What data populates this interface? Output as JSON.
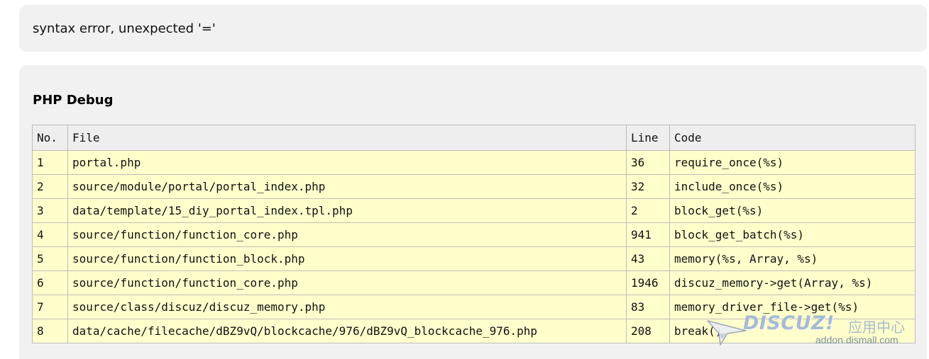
{
  "error": {
    "message": "syntax error, unexpected '='"
  },
  "debug": {
    "title": "PHP Debug",
    "columns": {
      "no": "No.",
      "file": "File",
      "line": "Line",
      "code": "Code"
    },
    "rows": [
      {
        "no": "1",
        "file": "portal.php",
        "line": "36",
        "code": "require_once(%s)"
      },
      {
        "no": "2",
        "file": "source/module/portal/portal_index.php",
        "line": "32",
        "code": "include_once(%s)"
      },
      {
        "no": "3",
        "file": "data/template/15_diy_portal_index.tpl.php",
        "line": "2",
        "code": "block_get(%s)"
      },
      {
        "no": "4",
        "file": "source/function/function_core.php",
        "line": "941",
        "code": "block_get_batch(%s)"
      },
      {
        "no": "5",
        "file": "source/function/function_block.php",
        "line": "43",
        "code": "memory(%s, Array, %s)"
      },
      {
        "no": "6",
        "file": "source/function/function_core.php",
        "line": "1946",
        "code": "discuz_memory->get(Array, %s)"
      },
      {
        "no": "7",
        "file": "source/class/discuz/discuz_memory.php",
        "line": "83",
        "code": "memory_driver_file->get(%s)"
      },
      {
        "no": "8",
        "file": "data/cache/filecache/dBZ9vQ/blockcache/976/dBZ9vQ_blockcache_976.php",
        "line": "208",
        "code": "break()"
      }
    ]
  },
  "watermark": {
    "brand": "DISCUZ!",
    "cn": "应用中心",
    "url": "addon.dismall.com",
    "icon": "bird-logo-icon"
  },
  "colors": {
    "panel_bg": "#f1f1f1",
    "header_bg": "#eeeeee",
    "row_bg": "#ffffcc",
    "border": "#bcbcbc"
  }
}
